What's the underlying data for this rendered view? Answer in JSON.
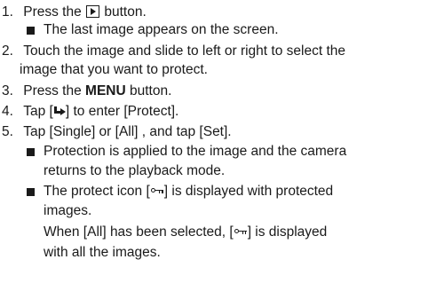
{
  "steps": [
    {
      "num": "1.",
      "pre": "Press the",
      "post": "button.",
      "icon": "play-icon"
    },
    {
      "num": "2.",
      "text_line1": "Touch the image and slide to left or right to  select the",
      "text_line2": "image that you want to protect."
    },
    {
      "num": "3.",
      "pre": "Press the",
      "bold": "MENU",
      "post": "button."
    },
    {
      "num": "4.",
      "pre": "Tap [",
      "post": "] to enter [Protect].",
      "icon": "enter-icon"
    },
    {
      "num": "5.",
      "text": "Tap [Single] or [All] , and tap [Set]."
    }
  ],
  "notes": {
    "step1": "The last image appears on the screen.",
    "step5_a_line1": "Protection is applied to the image and the camera",
    "step5_a_line2": "returns to the playback mode.",
    "step5_b_pre": "The protect icon [",
    "step5_b_post": "] is displayed with protected",
    "step5_b_line2": "images.",
    "step5_c_pre": "When [All] has been selected, [",
    "step5_c_post": "] is displayed",
    "step5_c_line2": "with all the images.",
    "icon": "key-icon"
  }
}
